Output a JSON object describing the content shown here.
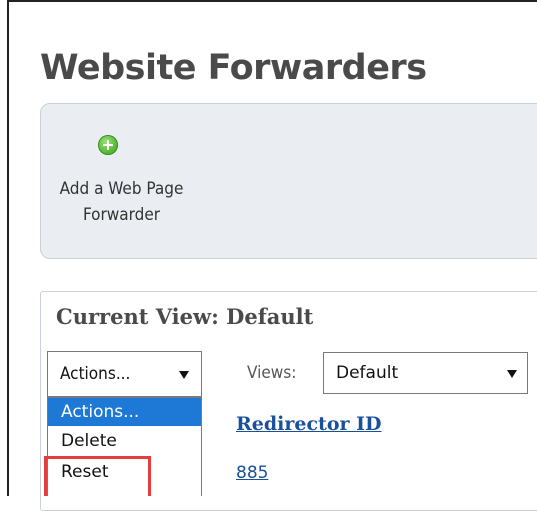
{
  "page": {
    "title": "Website Forwarders"
  },
  "toolbar": {
    "items": [
      {
        "icon": "plus-circle-icon",
        "label_line1": "Add a Web Page",
        "label_line2": "Forwarder"
      }
    ]
  },
  "view": {
    "title": "Current View: Default",
    "actions_select": {
      "value": "Actions...",
      "options": [
        "Actions...",
        "Delete",
        "Reset"
      ],
      "highlighted_option": "Reset"
    },
    "views_label": "Views:",
    "views_select": {
      "value": "Default"
    }
  },
  "table": {
    "columns": [
      "Redirector ID"
    ],
    "rows": [
      {
        "redirector_id": "885"
      }
    ]
  },
  "colors": {
    "title": "#4a4a4a",
    "panel_bg": "#eaedf1",
    "link": "#1a4f99",
    "selected_option_bg": "#1e78d6",
    "highlight_border": "#e53d3d"
  }
}
